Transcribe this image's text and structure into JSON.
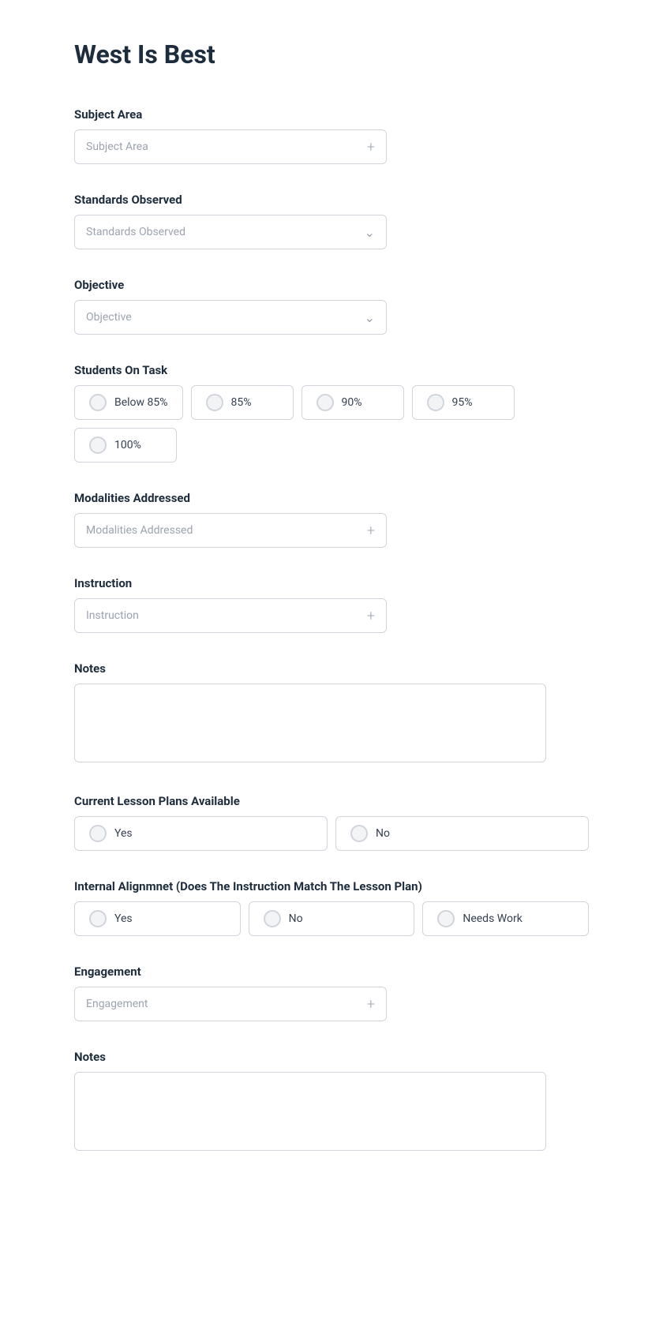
{
  "page": {
    "title": "West Is Best"
  },
  "sections": {
    "subject_area": {
      "label": "Subject Area",
      "placeholder": "Subject Area"
    },
    "standards_observed": {
      "label": "Standards Observed",
      "placeholder": "Standards Observed"
    },
    "objective": {
      "label": "Objective",
      "placeholder": "Objective"
    },
    "students_on_task": {
      "label": "Students On Task",
      "options": [
        "Below 85%",
        "85%",
        "90%",
        "95%",
        "100%"
      ]
    },
    "modalities_addressed": {
      "label": "Modalities Addressed",
      "placeholder": "Modalities Addressed"
    },
    "instruction": {
      "label": "Instruction",
      "placeholder": "Instruction"
    },
    "notes_1": {
      "label": "Notes",
      "placeholder": ""
    },
    "current_lesson_plans": {
      "label": "Current Lesson Plans Available",
      "options": [
        "Yes",
        "No"
      ]
    },
    "internal_alignment": {
      "label": "Internal Alignmnet (Does The Instruction Match The Lesson Plan)",
      "options": [
        "Yes",
        "No",
        "Needs Work"
      ]
    },
    "engagement": {
      "label": "Engagement",
      "placeholder": "Engagement"
    },
    "notes_2": {
      "label": "Notes",
      "placeholder": ""
    }
  }
}
